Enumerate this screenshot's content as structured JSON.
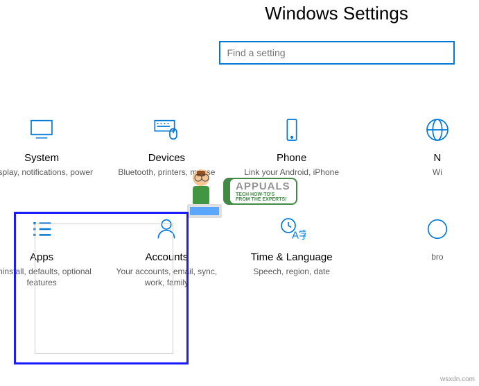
{
  "header": {
    "title": "Windows Settings"
  },
  "search": {
    "placeholder": "Find a setting"
  },
  "tiles": {
    "system": {
      "title": "System",
      "desc": "Display, notifications, power"
    },
    "devices": {
      "title": "Devices",
      "desc": "Bluetooth, printers, mouse"
    },
    "phone": {
      "title": "Phone",
      "desc": "Link your Android, iPhone"
    },
    "network": {
      "title": "N",
      "desc": "Wi"
    },
    "apps": {
      "title": "Apps",
      "desc": "Uninstall, defaults, optional features"
    },
    "accounts": {
      "title": "Accounts",
      "desc": "Your accounts, email, sync, work, family"
    },
    "time": {
      "title": "Time & Language",
      "desc": "Speech, region, date"
    },
    "cortana": {
      "title": "",
      "desc": "bro"
    }
  },
  "watermark": {
    "brand": "APPUALS",
    "tagline": "TECH HOW-TO'S FROM THE EXPERTS!"
  },
  "source": "wsxdn.com",
  "colors": {
    "accent": "#0078d7",
    "highlight": "#1a1aff"
  }
}
